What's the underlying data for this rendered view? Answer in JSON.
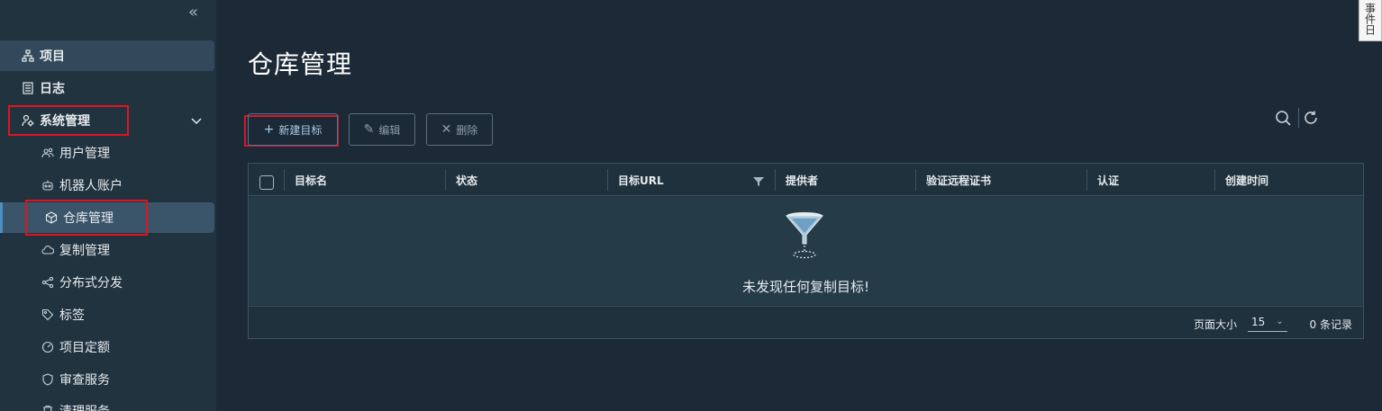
{
  "sidebar": {
    "items": [
      {
        "label": "项目",
        "icon": "project-icon"
      },
      {
        "label": "日志",
        "icon": "log-icon"
      },
      {
        "label": "系统管理",
        "icon": "system-admin-icon"
      }
    ],
    "sub_items": [
      {
        "label": "用户管理",
        "icon": "users-icon"
      },
      {
        "label": "机器人账户",
        "icon": "robot-icon"
      },
      {
        "label": "仓库管理",
        "icon": "cube-icon"
      },
      {
        "label": "复制管理",
        "icon": "cloud-icon"
      },
      {
        "label": "分布式分发",
        "icon": "share-icon"
      },
      {
        "label": "标签",
        "icon": "tag-icon"
      },
      {
        "label": "项目定额",
        "icon": "dashboard-icon"
      },
      {
        "label": "审查服务",
        "icon": "shield-icon"
      },
      {
        "label": "清理服务",
        "icon": "trash-icon"
      }
    ]
  },
  "main": {
    "title": "仓库管理",
    "toolbar": {
      "new_label": "新建目标",
      "edit_label": "编辑",
      "delete_label": "删除"
    },
    "grid": {
      "columns": [
        "目标名",
        "状态",
        "目标URL",
        "提供者",
        "验证远程证书",
        "认证",
        "创建时间"
      ],
      "empty_text": "未发现任何复制目标!",
      "footer": {
        "page_size_label": "页面大小",
        "page_size_value": "15",
        "record_count": "0 条记录"
      }
    }
  },
  "side_tab": {
    "label": "事件日"
  },
  "colors": {
    "highlight": "#e0141e",
    "accent": "#4a90c6",
    "background": "#1b2a36"
  }
}
